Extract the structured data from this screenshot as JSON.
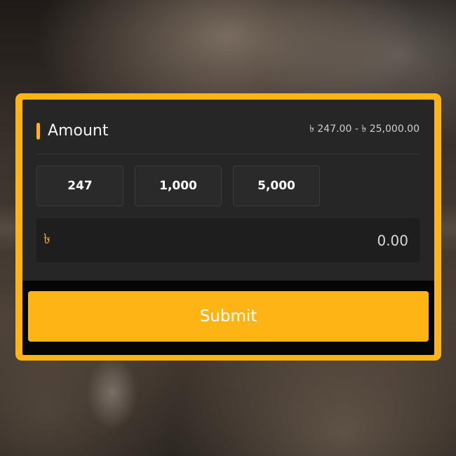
{
  "amount": {
    "title": "Amount",
    "range": "৳ 247.00 - ৳ 25,000.00",
    "presets": [
      "247",
      "1,000",
      "5,000"
    ],
    "currency_symbol": "৳",
    "input_placeholder": "0.00"
  },
  "actions": {
    "submit_label": "Submit"
  },
  "colors": {
    "accent": "#fdb414",
    "panel": "#262626",
    "input_bg": "#1e1e1e"
  }
}
